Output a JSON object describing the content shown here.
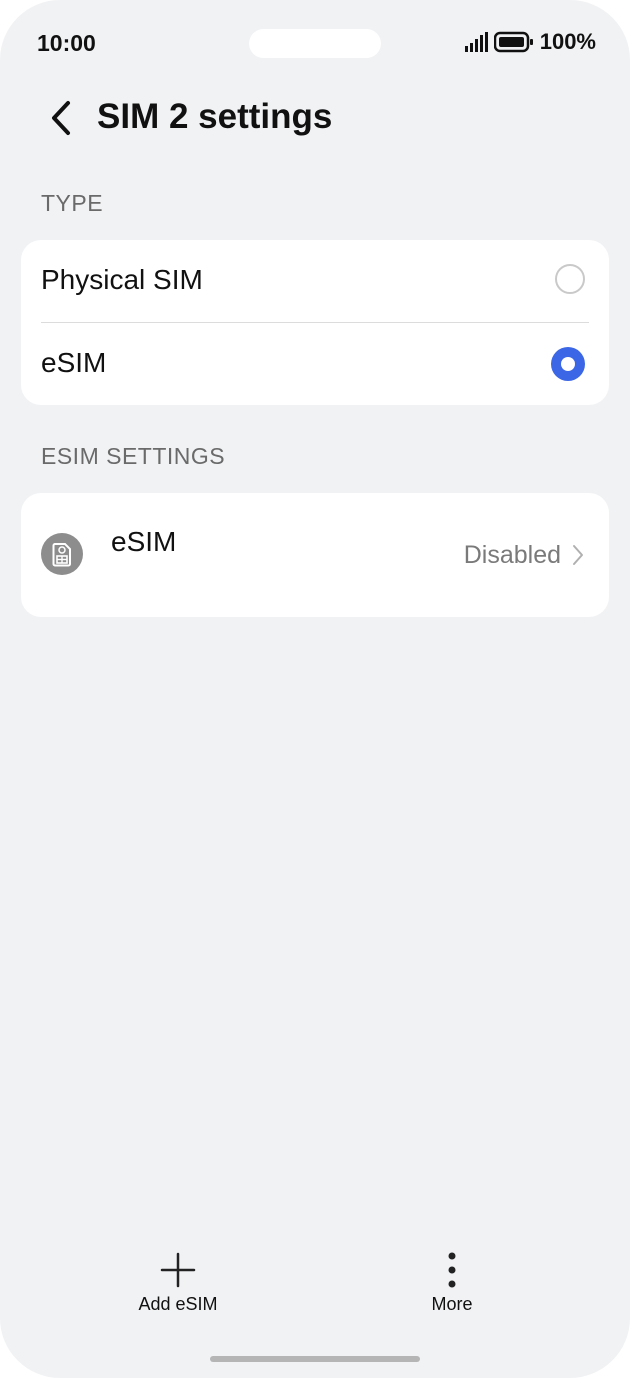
{
  "status_bar": {
    "time": "10:00",
    "battery": "100%",
    "signal_icon": "signal-bars-icon",
    "battery_icon": "battery-icon"
  },
  "header": {
    "title": "SIM 2 settings",
    "back_icon": "back-arrow-icon"
  },
  "type_section": {
    "label": "TYPE",
    "options": [
      {
        "label": "Physical SIM",
        "selected": false
      },
      {
        "label": "eSIM",
        "selected": true
      }
    ]
  },
  "esim_section": {
    "label": "ESIM SETTINGS",
    "item": {
      "label": "eSIM",
      "value": "Disabled",
      "icon": "esim-card-icon"
    }
  },
  "bottom_bar": {
    "add_label": "Add eSIM",
    "more_label": "More"
  },
  "colors": {
    "accent": "#3b66e5",
    "background": "#f1f2f4"
  }
}
